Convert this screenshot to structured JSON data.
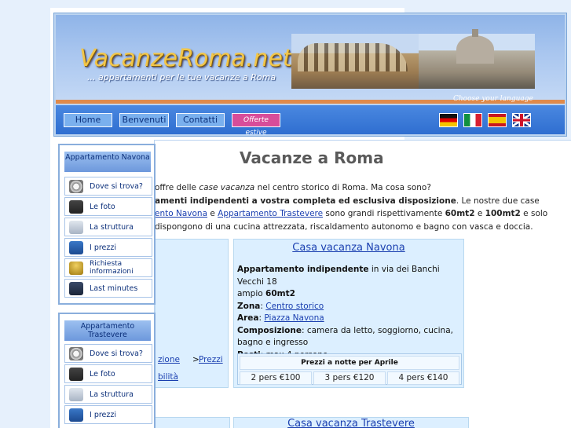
{
  "header": {
    "logo": "VacanzeRoma.net",
    "tagline": "... appartamenti per le tue vacanze a Roma",
    "choose_language": "Choose your language",
    "nav": [
      "Home",
      "Benvenuti",
      "Contatti",
      "Offerte estive"
    ],
    "flags": [
      "flag-germany",
      "flag-italy",
      "flag-spain",
      "flag-uk"
    ]
  },
  "sidebar": {
    "box1": {
      "title": "Appartamento Navona",
      "items": [
        {
          "label": "Dove si trova?",
          "icon": "compass-icon"
        },
        {
          "label": "Le foto",
          "icon": "camera-icon"
        },
        {
          "label": "La struttura",
          "icon": "house-icon"
        },
        {
          "label": "I prezzi",
          "icon": "price-icon"
        },
        {
          "label": "Richiesta informazioni",
          "icon": "bell-icon"
        },
        {
          "label": "Last minutes",
          "icon": "notebook-icon"
        }
      ]
    },
    "box2": {
      "title": "Appartamento Trastevere",
      "items": [
        {
          "label": "Dove si trova?",
          "icon": "compass-icon"
        },
        {
          "label": "Le foto",
          "icon": "camera-icon"
        },
        {
          "label": "La struttura",
          "icon": "house-icon"
        },
        {
          "label": "I prezzi",
          "icon": "price-icon"
        }
      ]
    }
  },
  "main": {
    "title": "Vacanze a Roma",
    "intro": {
      "l1_pre": "offre delle ",
      "l1_em": "case vacanza",
      "l1_post": " nel centro storico di Roma. Ma cosa sono?",
      "l2_bold": "amenti indipendenti a vostra completa ed esclusiva disposizione",
      "l2_post": ". Le nostre due case",
      "l3_link1": "ento Navona",
      "l3_mid": " e ",
      "l3_link2": "Appartamento Trastevere",
      "l3_mid2": " sono grandi rispettivamente ",
      "l3_b1": "60mt2",
      "l3_and": " e ",
      "l3_b2": "100mt2",
      "l3_post": " e solo",
      "l4": "dispongono di una cucina attrezzata, riscaldamento autonomo e bagno con vasca e doccia."
    },
    "card": {
      "title": "Casa vacanza Navona",
      "l1_bold": "Appartamento indipendente",
      "l1_post": " in via dei Banchi Vecchi 18",
      "l2_pre": "ampio ",
      "l2_bold": "60mt2",
      "zona_label": "Zona",
      "zona_value": "Centro storico",
      "area_label": "Area",
      "area_value": "Piazza Navona",
      "comp_label": "Composizione",
      "comp_value": ": camera da letto, soggiorno, cucina, bagno e ingresso",
      "posti_label": "Posti",
      "posti_value": ": max 4 persone",
      "prices_head": "Prezzi a notte per Aprile",
      "prices": [
        "2 pers €100",
        "3 pers €120",
        "4 pers €140"
      ]
    },
    "left_links": {
      "a": "zione",
      "b": ">",
      "c": "Prezzi",
      "d": "bilità"
    },
    "card2_title": "Casa vacanza Trastevere"
  }
}
